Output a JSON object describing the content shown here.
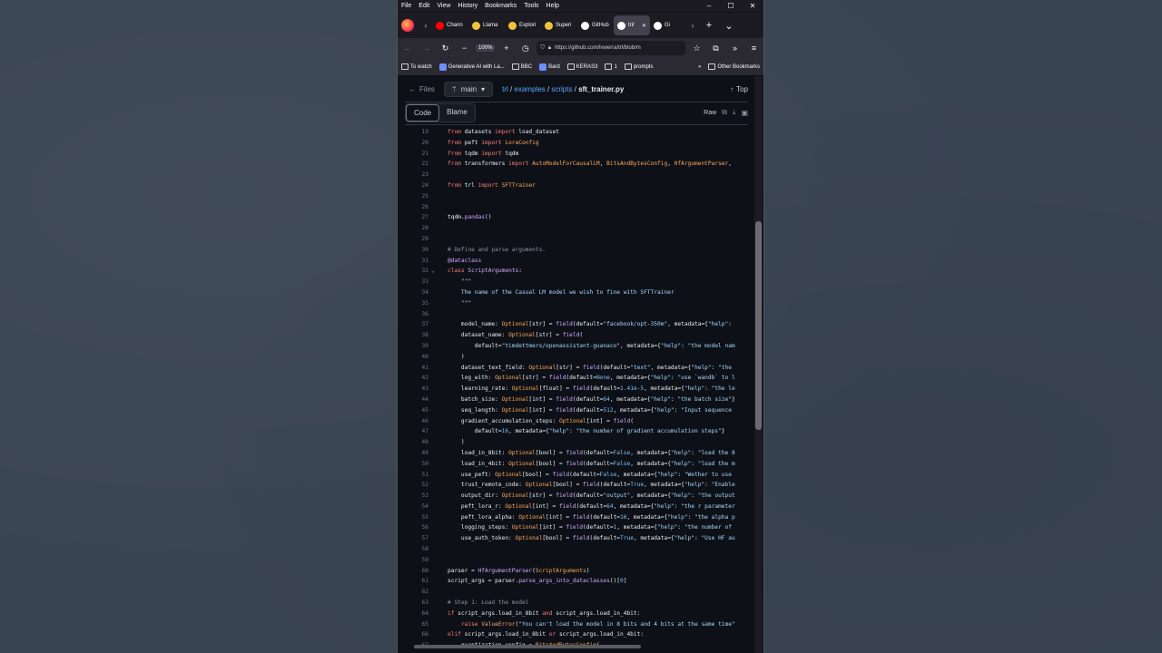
{
  "menubar": {
    "items": [
      "File",
      "Edit",
      "View",
      "History",
      "Bookmarks",
      "Tools",
      "Help"
    ],
    "min": "–",
    "max": "☐",
    "close": "✕"
  },
  "tabs": [
    {
      "label": "Chann",
      "color": "#ff0000"
    },
    {
      "label": "Llama",
      "color": "#f0c33c"
    },
    {
      "label": "Explori",
      "color": "#f0c33c"
    },
    {
      "label": "Superi",
      "color": "#f0c33c"
    },
    {
      "label": "GitHub",
      "color": "#ffffff"
    },
    {
      "label": "trl/",
      "color": "#ffffff",
      "active": true
    },
    {
      "label": "Gi",
      "color": "#ffffff"
    }
  ],
  "nav": {
    "zoom": "100%",
    "url": "https://github.com/lvwerra/trl/blob/m"
  },
  "bookmarks": [
    {
      "label": "To watch",
      "type": "folder"
    },
    {
      "label": "Generative AI with La...",
      "type": "site"
    },
    {
      "label": "BBC",
      "type": "folder"
    },
    {
      "label": "Bard",
      "type": "site"
    },
    {
      "label": "KERAS3",
      "type": "folder"
    },
    {
      "label": "1",
      "type": "folder"
    },
    {
      "label": "prompts",
      "type": "folder"
    }
  ],
  "bookmarks_other": "Other Bookmarks",
  "github": {
    "files_label": "Files",
    "branch": "main",
    "crumbs": [
      "trl",
      "examples",
      "scripts"
    ],
    "file": "sft_trainer.py",
    "top_label": "Top",
    "code_tab": "Code",
    "blame_tab": "Blame",
    "raw_label": "Raw"
  },
  "code_lines": [
    {
      "n": "19",
      "html": "<span class='kw'>from</span> datasets <span class='kw'>import</span> load_dataset"
    },
    {
      "n": "20",
      "html": "<span class='kw'>from</span> peft <span class='kw'>import</span> <span class='param'>LoraConfig</span>"
    },
    {
      "n": "21",
      "html": "<span class='kw'>from</span> tqdm <span class='kw'>import</span> tqdm"
    },
    {
      "n": "22",
      "html": "<span class='kw'>from</span> transformers <span class='kw'>import</span> <span class='param'>AutoModelForCausalLM</span>, <span class='param'>BitsAndBytesConfig</span>, <span class='param'>HfArgumentParser</span>,"
    },
    {
      "n": "23",
      "html": ""
    },
    {
      "n": "24",
      "html": "<span class='kw'>from</span> trl <span class='kw'>import</span> <span class='param'>SFTTrainer</span>"
    },
    {
      "n": "25",
      "html": ""
    },
    {
      "n": "26",
      "html": ""
    },
    {
      "n": "27",
      "html": "tqdm.<span class='cls'>pandas</span>()"
    },
    {
      "n": "28",
      "html": ""
    },
    {
      "n": "29",
      "html": ""
    },
    {
      "n": "30",
      "html": "<span class='cm'># Define and parse arguments.</span>"
    },
    {
      "n": "31",
      "html": "<span class='cls'>@dataclass</span>"
    },
    {
      "n": "32",
      "html": "<span class='kw'>class</span> <span class='cls'>ScriptArguments</span>:",
      "fold": true
    },
    {
      "n": "33",
      "html": "    <span class='str'>\"\"\"</span>"
    },
    {
      "n": "34",
      "html": "    <span class='str'>The name of the Casual LM model we wish to fine with SFTTrainer</span>"
    },
    {
      "n": "35",
      "html": "    <span class='str'>\"\"\"</span>"
    },
    {
      "n": "36",
      "html": ""
    },
    {
      "n": "37",
      "html": "    model_name: <span class='param'>Optional</span>[str] = <span class='cls'>field</span>(default=<span class='str'>\"facebook/opt-350m\"</span>, metadata={<span class='str'>\"help\"</span>:"
    },
    {
      "n": "38",
      "html": "    dataset_name: <span class='param'>Optional</span>[str] = <span class='cls'>field</span>("
    },
    {
      "n": "39",
      "html": "        default=<span class='str'>\"timdettmers/openassistant-guanaco\"</span>, metadata={<span class='str'>\"help\"</span>: <span class='str'>\"the model nam</span>"
    },
    {
      "n": "40",
      "html": "    )"
    },
    {
      "n": "41",
      "html": "    dataset_text_field: <span class='param'>Optional</span>[str] = <span class='cls'>field</span>(default=<span class='str'>\"text\"</span>, metadata={<span class='str'>\"help\"</span>: <span class='str'>\"the</span>"
    },
    {
      "n": "42",
      "html": "    log_with: <span class='param'>Optional</span>[str] = <span class='cls'>field</span>(default=<span class='num'>None</span>, metadata={<span class='str'>\"help\"</span>: <span class='str'>\"use `wandb` to l</span>"
    },
    {
      "n": "43",
      "html": "    learning_rate: <span class='param'>Optional</span>[float] = <span class='cls'>field</span>(default=<span class='num'>1.41e-5</span>, metadata={<span class='str'>\"help\"</span>: <span class='str'>\"the le</span>"
    },
    {
      "n": "44",
      "html": "    batch_size: <span class='param'>Optional</span>[int] = <span class='cls'>field</span>(default=<span class='num'>64</span>, metadata={<span class='str'>\"help\"</span>: <span class='str'>\"the batch size\"</span>}"
    },
    {
      "n": "45",
      "html": "    seq_length: <span class='param'>Optional</span>[int] = <span class='cls'>field</span>(default=<span class='num'>512</span>, metadata={<span class='str'>\"help\"</span>: <span class='str'>\"Input sequence</span>"
    },
    {
      "n": "46",
      "html": "    gradient_accumulation_steps: <span class='param'>Optional</span>[int] = <span class='cls'>field</span>("
    },
    {
      "n": "47",
      "html": "        default=<span class='num'>16</span>, metadata={<span class='str'>\"help\"</span>: <span class='str'>\"the number of gradient accumulation steps\"</span>}"
    },
    {
      "n": "48",
      "html": "    )"
    },
    {
      "n": "49",
      "html": "    load_in_8bit: <span class='param'>Optional</span>[bool] = <span class='cls'>field</span>(default=<span class='num'>False</span>, metadata={<span class='str'>\"help\"</span>: <span class='str'>\"load the 8</span>"
    },
    {
      "n": "50",
      "html": "    load_in_4bit: <span class='param'>Optional</span>[bool] = <span class='cls'>field</span>(default=<span class='num'>False</span>, metadata={<span class='str'>\"help\"</span>: <span class='str'>\"load the m</span>"
    },
    {
      "n": "51",
      "html": "    use_peft: <span class='param'>Optional</span>[bool] = <span class='cls'>field</span>(default=<span class='num'>False</span>, metadata={<span class='str'>\"help\"</span>: <span class='str'>\"Wether to use</span>"
    },
    {
      "n": "52",
      "html": "    trust_remote_code: <span class='param'>Optional</span>[bool] = <span class='cls'>field</span>(default=<span class='num'>True</span>, metadata={<span class='str'>\"help\"</span>: <span class='str'>\"Enable</span>"
    },
    {
      "n": "53",
      "html": "    output_dir: <span class='param'>Optional</span>[str] = <span class='cls'>field</span>(default=<span class='str'>\"output\"</span>, metadata={<span class='str'>\"help\"</span>: <span class='str'>\"the output</span>"
    },
    {
      "n": "54",
      "html": "    peft_lora_r: <span class='param'>Optional</span>[int] = <span class='cls'>field</span>(default=<span class='num'>64</span>, metadata={<span class='str'>\"help\"</span>: <span class='str'>\"the r parameter</span>"
    },
    {
      "n": "55",
      "html": "    peft_lora_alpha: <span class='param'>Optional</span>[int] = <span class='cls'>field</span>(default=<span class='num'>16</span>, metadata={<span class='str'>\"help\"</span>: <span class='str'>\"the alpha p</span>"
    },
    {
      "n": "56",
      "html": "    logging_steps: <span class='param'>Optional</span>[int] = <span class='cls'>field</span>(default=<span class='num'>1</span>, metadata={<span class='str'>\"help\"</span>: <span class='str'>\"the number of</span>"
    },
    {
      "n": "57",
      "html": "    use_auth_token: <span class='param'>Optional</span>[bool] = <span class='cls'>field</span>(default=<span class='num'>True</span>, metadata={<span class='str'>\"help\"</span>: <span class='str'>\"Use HF au</span>"
    },
    {
      "n": "58",
      "html": ""
    },
    {
      "n": "59",
      "html": ""
    },
    {
      "n": "60",
      "html": "parser = <span class='cls'>HfArgumentParser</span>(<span class='param'>ScriptArguments</span>)"
    },
    {
      "n": "61",
      "html": "script_args = parser.<span class='cls'>parse_args_into_dataclasses</span>()[<span class='num'>0</span>]"
    },
    {
      "n": "62",
      "html": ""
    },
    {
      "n": "63",
      "html": "<span class='cm'># Step 1: Load the model</span>"
    },
    {
      "n": "64",
      "html": "<span class='kw'>if</span> script_args.load_in_8bit <span class='kw'>and</span> script_args.load_in_4bit:"
    },
    {
      "n": "65",
      "html": "    <span class='kw'>raise</span> <span class='param'>ValueError</span>(<span class='str'>\"You can't load the model in 8 bits and 4 bits at the same time\"</span>"
    },
    {
      "n": "66",
      "html": "<span class='kw'>elif</span> script_args.load_in_8bit <span class='kw'>or</span> script_args.load_in_4bit:"
    },
    {
      "n": "67",
      "html": "    quantization_config = <span class='param'>BitsAndBytesConfig</span>("
    }
  ]
}
